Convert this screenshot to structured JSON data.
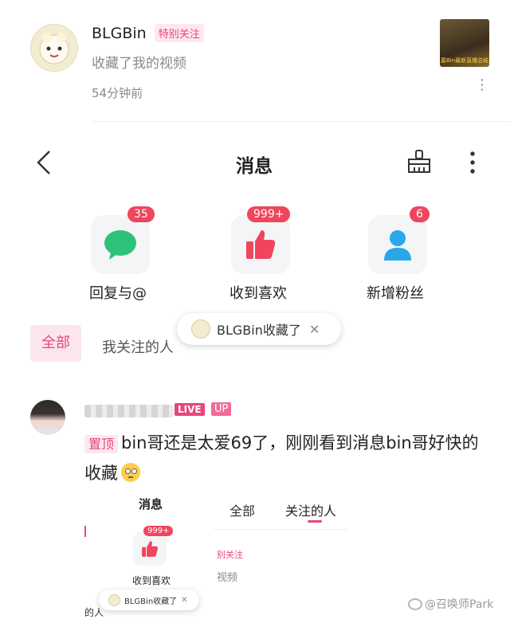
{
  "notif": {
    "username": "BLGBin",
    "tag": "特别关注",
    "action": "收藏了我的视频",
    "time": "54分钟前",
    "thumb_text": "嘉Bin最新直播总结"
  },
  "header": {
    "title": "消息"
  },
  "categories": [
    {
      "label": "回复与@",
      "badge": "35",
      "icon": "chat-bubble-icon",
      "color": "#2ec17a"
    },
    {
      "label": "收到喜欢",
      "badge": "999+",
      "icon": "thumbs-up-icon",
      "color": "#f0455c"
    },
    {
      "label": "新增粉丝",
      "badge": "6",
      "icon": "person-icon",
      "color": "#2aa7ea"
    }
  ],
  "filters": {
    "all": "全部",
    "following": "我关注的人"
  },
  "toast": {
    "text": "BLGBin收藏了"
  },
  "comment": {
    "badges": {
      "live": "LIVE",
      "up": "UP"
    },
    "pin": "置顶",
    "text": "bin哥还是太爱69了，刚刚看到消息bin哥好快的收藏"
  },
  "inset": {
    "title": "消息",
    "tab_all": "全部",
    "tab_following": "关注的人",
    "badge": "999+",
    "like_label": "收到喜欢",
    "tag": "别关注",
    "video": "视频",
    "toast": "BLGBin收藏了",
    "people": "的人"
  },
  "watermark": "@召唤师Park"
}
